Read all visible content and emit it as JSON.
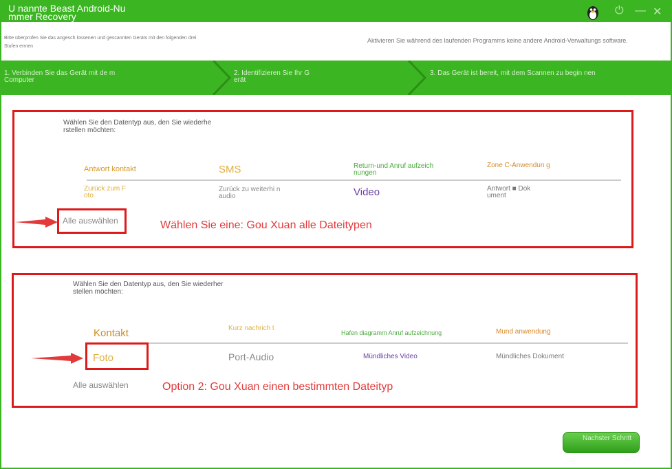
{
  "window": {
    "title": "U nannte Beast Android-Nu mmer Recovery"
  },
  "info_bar": {
    "left_text": "Bitte überprüfen Sie das angesch lossenen und gescannten Geräts mit den folgenden drei Stufen ermen",
    "right_text": "Aktivieren Sie während des laufenden Programms keine andere Android-Verwaltungs software."
  },
  "steps": [
    "1. Verbinden Sie das Gerät mit de m Computer",
    "2. Identifizieren Sie Ihr G erät",
    "3. Das Gerät ist bereit, mit dem Scannen zu begin nen"
  ],
  "panel1": {
    "prompt": "Wählen Sie den Datentyp aus, den Sie wiederhe rstellen möchten:",
    "row1": [
      "Antwort kontakt",
      "SMS",
      "Return-und Anruf aufzeich nungen",
      "Zone C-Anwendun g"
    ],
    "row2": [
      "Zurück zum F oto",
      "Zurück zu weiterhi n audio",
      "Video",
      "Antwort ■ Dok ument"
    ],
    "select_all": "Alle auswählen",
    "annotation": "Wählen Sie eine: Gou Xuan alle Dateitypen"
  },
  "panel2": {
    "prompt": "Wählen Sie den Datentyp aus, den Sie wiederher stellen möchten:",
    "row1": [
      "Kontakt",
      "Kurz nachrich t",
      "Hafen diagramm Anruf aufzeichnung",
      "Mund anwendung"
    ],
    "row2": [
      "Foto",
      "Port-Audio",
      "Mündliches Video",
      "Mündliches Dokument"
    ],
    "select_all": "Alle auswählen",
    "annotation": "Option 2: Gou Xuan einen bestimmten Dateityp"
  },
  "next_button": "Nachster Schritt",
  "colors": {
    "brand_green": "#3bb521",
    "annotation_red": "#dd1a1a"
  }
}
